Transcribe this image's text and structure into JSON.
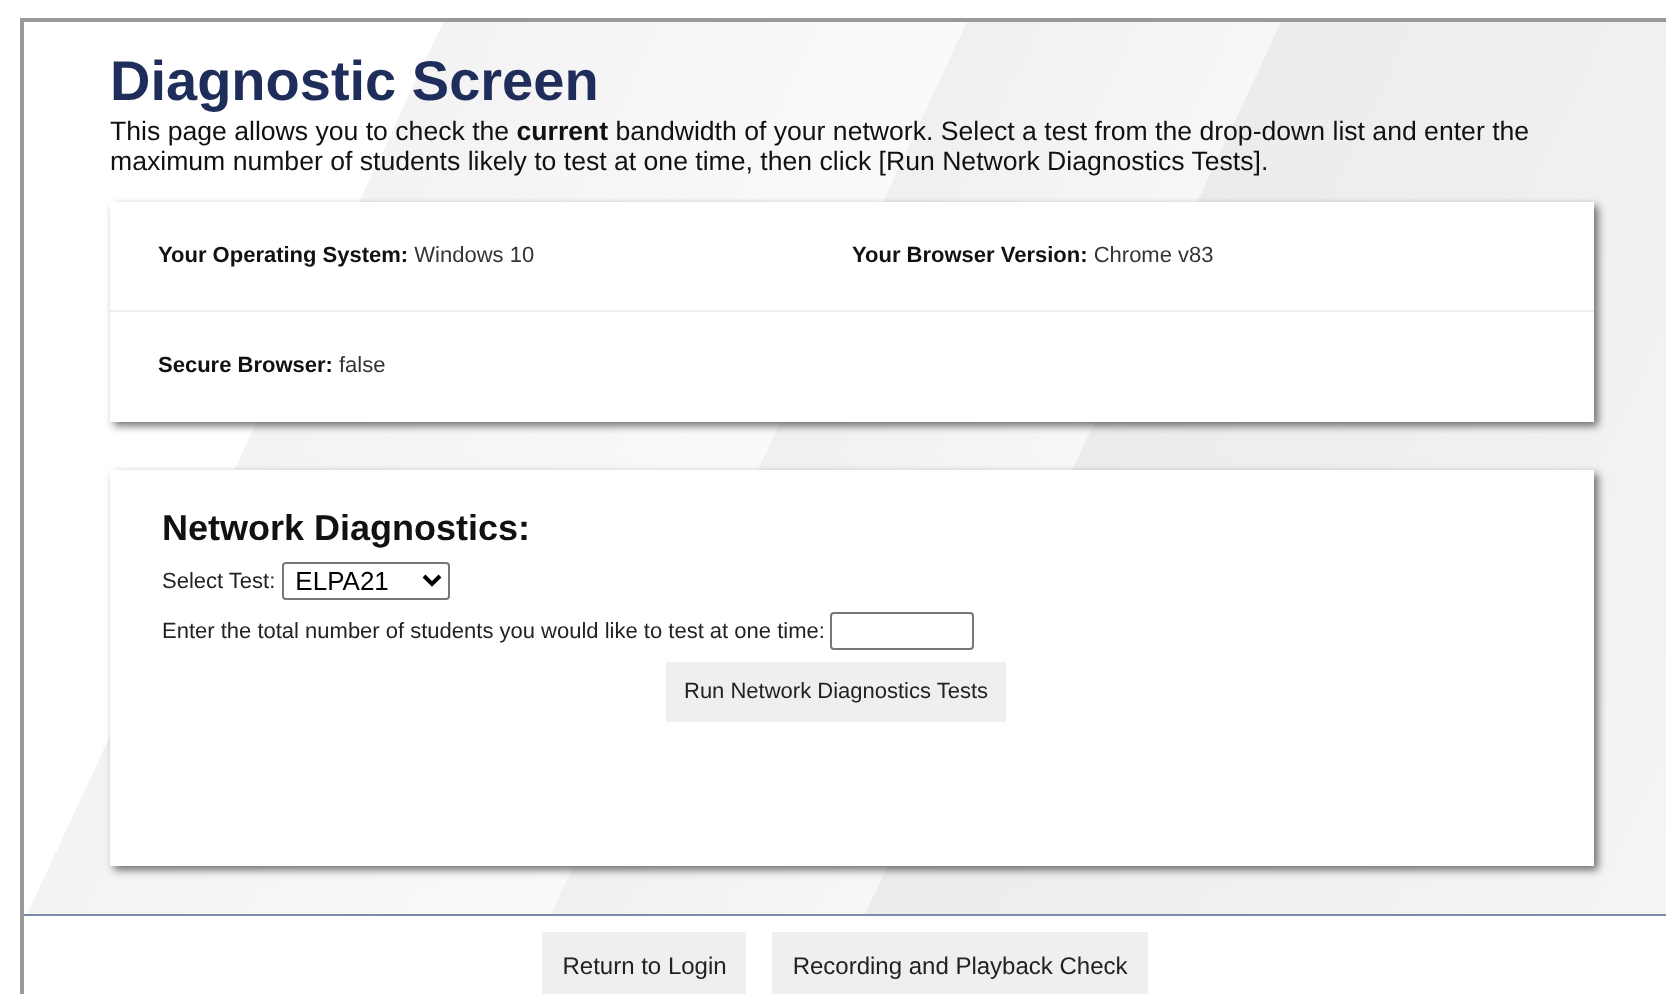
{
  "page": {
    "title": "Diagnostic Screen",
    "description": "This page allows you to check the **current** bandwidth of your network. Select a test from the drop-down list and enter the maximum number of students likely to test at one time, then click [Run Network Diagnostics Tests]."
  },
  "system_info": [
    {
      "label": "Your Operating System:",
      "value": "Windows 10"
    },
    {
      "label": "Your Browser Version:",
      "value": "Chrome v83"
    },
    {
      "label": "Secure Browser:",
      "value": "false"
    }
  ],
  "network_diagnostics": {
    "title": "Network Diagnostics:",
    "select_label": "Select Test:",
    "select_value": "ELPA21",
    "students_label": "Enter the total number of students you would like to test at one time:",
    "run_button": "Run Network Diagnostics Tests"
  },
  "footer_buttons": [
    "Return to Login",
    "Recording and Playback Check"
  ]
}
